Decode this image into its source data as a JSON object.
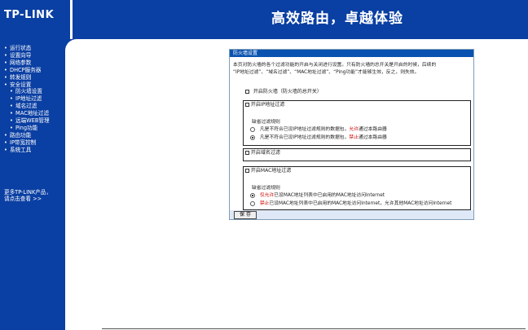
{
  "header": {
    "logo": "TP-LINK",
    "slogan": "高效路由，卓越体验"
  },
  "sidebar": {
    "items": [
      {
        "label": "运行状态",
        "sub": false
      },
      {
        "label": "设置向导",
        "sub": false
      },
      {
        "label": "网络参数",
        "sub": false
      },
      {
        "label": "DHCP服务器",
        "sub": false
      },
      {
        "label": "转发规则",
        "sub": false
      },
      {
        "label": "安全设置",
        "sub": false
      },
      {
        "label": "防火墙设置",
        "sub": true
      },
      {
        "label": "IP地址过滤",
        "sub": true
      },
      {
        "label": "域名过滤",
        "sub": true
      },
      {
        "label": "MAC地址过滤",
        "sub": true
      },
      {
        "label": "远端WEB管理",
        "sub": true
      },
      {
        "label": "Ping功能",
        "sub": true
      },
      {
        "label": "路由功能",
        "sub": false
      },
      {
        "label": "IP带宽控制",
        "sub": false
      },
      {
        "label": "系统工具",
        "sub": false
      }
    ],
    "bullet": "•",
    "more_line1": "更多TP-LINK产品，",
    "more_line2": "请点击查看 >>"
  },
  "panel": {
    "title": "防火墙设置",
    "desc_line1": "本页对防火墙的各个过滤功能的开启与关闭进行设置。只有防火墙的总开关是开启的时候，后续的",
    "desc_line2": "“IP地址过滤”、“域名过滤”、“MAC地址过滤”、“Ping功能”才能够生效，反之，则失效。",
    "fw_toggle_label": "开启防火墙（防火墙的总开关）",
    "ip_filter": {
      "enable_label": "开启IP地址过滤",
      "rule_title": "缺省过滤规则",
      "opt1_pre": "凡是不符合已设IP地址过滤规则的数据包，",
      "opt1_red": "允许",
      "opt1_post": "通过本路由器",
      "opt2_pre": "凡是不符合已设IP地址过滤规则的数据包，",
      "opt2_red": "禁止",
      "opt2_post": "通过本路由器"
    },
    "domain_filter": {
      "enable_label": "开启域名过滤"
    },
    "mac_filter": {
      "enable_label": "开启MAC地址过滤",
      "rule_title": "缺省过滤规则",
      "opt1_red": "仅允许",
      "opt1_post": "已设MAC地址列表中已启用的MAC地址访问Internet",
      "opt2_red": "禁止",
      "opt2_post": "已设MAC地址列表中已启用的MAC地址访问Internet，允许其他MAC地址访问Internet"
    },
    "save_label": "保 存"
  },
  "colors": {
    "brand_blue": "#0a3fa3",
    "title_blue": "#0a52b0",
    "warn_red": "#d00000"
  }
}
